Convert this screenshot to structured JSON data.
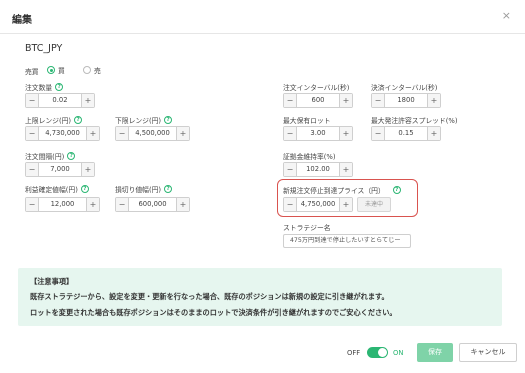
{
  "dialog": {
    "title": "編集",
    "close_icon": "×"
  },
  "pair": "BTC_JPY",
  "side": {
    "label": "売買",
    "buy": "買",
    "sell": "売",
    "selected": "buy"
  },
  "help_glyph": "?",
  "minus": "−",
  "plus": "+",
  "fields": {
    "order_qty": {
      "label": "注文数量",
      "value": "0.02"
    },
    "upper_range": {
      "label": "上限レンジ(円)",
      "value": "4,730,000"
    },
    "lower_range": {
      "label": "下限レンジ(円)",
      "value": "4,500,000"
    },
    "order_interval": {
      "label": "注文間隔(円)",
      "value": "7,000"
    },
    "take_profit": {
      "label": "利益確定値幅(円)",
      "value": "12,000"
    },
    "stop_loss": {
      "label": "損切り値幅(円)",
      "value": "600,000"
    },
    "order_interval_sec": {
      "label": "注文インターバル(秒)",
      "value": "600"
    },
    "settle_interval_sec": {
      "label": "決済インターバル(秒)",
      "value": "1800"
    },
    "max_lot": {
      "label": "最大保有ロット",
      "value": "3.00"
    },
    "max_spread": {
      "label": "最大発注許容スプレッド(%)",
      "value": "0.15"
    },
    "margin_rate": {
      "label": "証拠金維持率(%)",
      "value": "102.00"
    },
    "stop_price": {
      "label": "新規注文停止到達プライス（円）",
      "value": "4,750,000",
      "status": "未達中"
    }
  },
  "strategy_name": {
    "label": "ストラテジー名",
    "value": "475万円到達で停止したいすとらてじー"
  },
  "notice": {
    "heading": "【注意事項】",
    "line1": "既存ストラテジーから、設定を変更・更新を行なった場合、既存のポジションは新規の設定に引き継がれます。",
    "line2": "ロットを変更された場合も既存ポジションはそのままのロットで決済条件が引き継がれますのでご安心ください。"
  },
  "footer": {
    "off": "OFF",
    "on": "ON",
    "save": "保存",
    "cancel": "キャンセル"
  },
  "colors": {
    "accent": "#2bb673",
    "highlight": "#d9534f",
    "notice_bg": "#e6f6ef"
  }
}
